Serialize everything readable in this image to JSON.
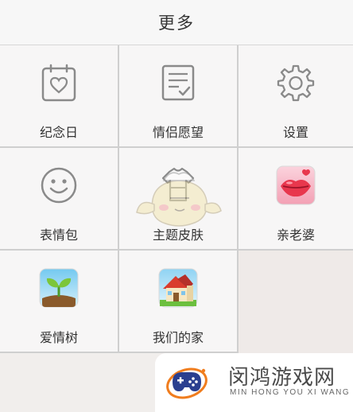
{
  "header": {
    "title": "更多"
  },
  "grid": {
    "items": [
      {
        "label": "纪念日",
        "icon": "calendar-heart-icon"
      },
      {
        "label": "情侣愿望",
        "icon": "wish-list-icon"
      },
      {
        "label": "设置",
        "icon": "gear-icon"
      },
      {
        "label": "表情包",
        "icon": "smiley-icon"
      },
      {
        "label": "主题皮肤",
        "icon": "theme-skin-icon"
      },
      {
        "label": "亲老婆",
        "icon": "kiss-lips-icon"
      },
      {
        "label": "爱情树",
        "icon": "sprout-icon"
      },
      {
        "label": "我们的家",
        "icon": "house-icon"
      }
    ]
  },
  "watermark": {
    "name_cn": "闵鸿游戏网",
    "name_en": "MIN HONG YOU XI WANG",
    "logo": "gamepad-logo"
  },
  "colors": {
    "icon_stroke": "#8a8a8a",
    "cell_bg": "#f7f6f6",
    "divider": "#cfcfcf",
    "lips_red": "#e8374d",
    "logo_blue": "#2a3f8f",
    "logo_orange": "#f07d1e"
  }
}
